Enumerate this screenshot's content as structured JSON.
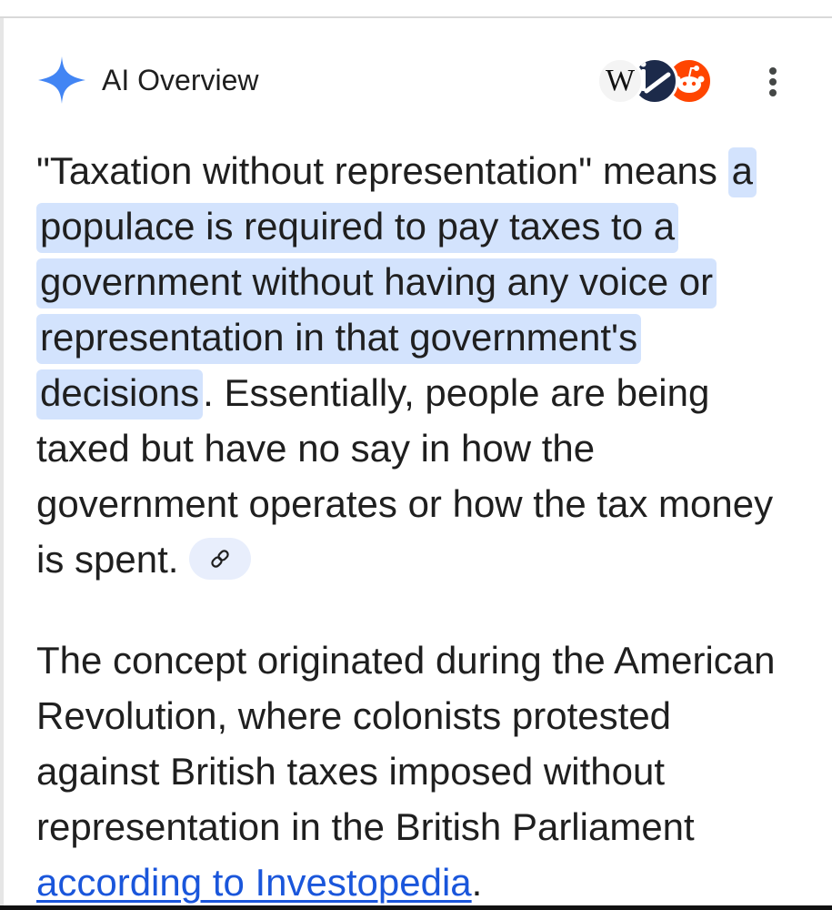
{
  "header": {
    "title": "AI Overview",
    "icon": "sparkle-icon",
    "accent_color": "#4285f4",
    "sources": [
      {
        "name": "wikipedia-icon",
        "glyph": "W"
      },
      {
        "name": "investopedia-icon"
      },
      {
        "name": "reddit-icon"
      }
    ],
    "menu_icon": "more-vert-icon"
  },
  "overview": {
    "p1_start": "\"Taxation without representation\" means ",
    "p1_highlight": "a populace is required to pay taxes to a government without having any voice or representation in that government's decisions",
    "p1_end": ". Essentially, people are being taxed but have no say in how the government operates or how the tax money is spent.",
    "citation_icon": "link-icon",
    "p2_start": "The concept originated during the American Revolution, where colonists protested against British taxes imposed without representation in the British Parliament ",
    "p2_link": "according to Investopedia",
    "p2_end": "."
  },
  "colors": {
    "highlight": "#d3e3fd",
    "link": "#1a56db",
    "text": "#1f1f1f"
  }
}
